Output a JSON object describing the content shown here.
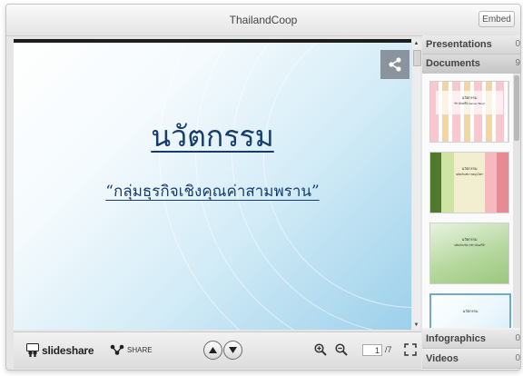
{
  "window": {
    "title": "ThailandCoop",
    "embed_label": "Embed"
  },
  "slide": {
    "title": "นวัตกรรม",
    "subtitle": "“กลุ่มธุรกิจเชิงคุณค่าสามพราน”",
    "current_page": "1",
    "total_pages": "/7"
  },
  "toolbar": {
    "brand_label": "slideshare",
    "share_label": "SHARE"
  },
  "sidebar": {
    "sections": [
      {
        "label": "Presentations",
        "count": "0"
      },
      {
        "label": "Documents",
        "count": "9"
      },
      {
        "label": "Infographics",
        "count": "0"
      },
      {
        "label": "Videos",
        "count": "0"
      }
    ],
    "documents": [
      {
        "title": "นวัตกรรม",
        "subtitle": "“ข้าวอินทรีย์ Farmer Shop”"
      },
      {
        "title": "นวัตกรรม",
        "subtitle": "“ผลิตภัณฑ์จากสมุนไพร”"
      },
      {
        "title": "นวัตกรรม",
        "subtitle": "“ผลิตภัณฑ์จากข้าวอินทรีย์”"
      },
      {
        "title": "นวัตกรรม",
        "subtitle": ""
      }
    ]
  },
  "colors": {
    "slide_text": "#163d6e",
    "slide_bg_light": "#ffffff",
    "slide_bg_dark": "#9cd0ea",
    "share_float_bg": "#8a949d",
    "selected_border": "#6fa9cf"
  }
}
